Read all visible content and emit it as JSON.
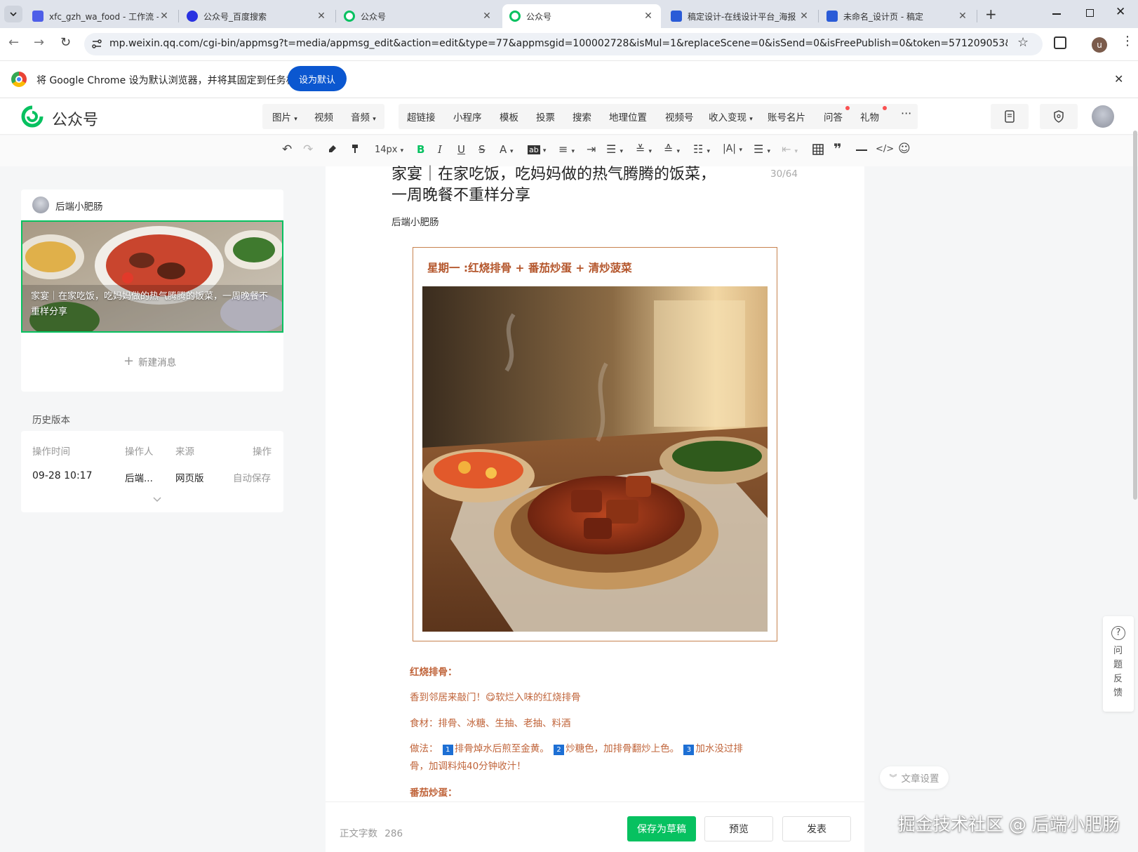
{
  "browser": {
    "tabs": [
      {
        "title": "xfc_gzh_wa_food - 工作流 -",
        "favicon": "coze-icon",
        "color": "#4e5ee8",
        "active": false
      },
      {
        "title": "公众号_百度搜索",
        "favicon": "baidu-paw-icon",
        "color": "#2932e1",
        "active": false
      },
      {
        "title": "公众号",
        "favicon": "wechat-mp-icon",
        "color": "#07c160",
        "active": false
      },
      {
        "title": "公众号",
        "favicon": "wechat-mp-icon",
        "color": "#07c160",
        "active": true
      },
      {
        "title": "稿定设计-在线设计平台_海报",
        "favicon": "gaoding-icon",
        "color": "#2a5bd7",
        "active": false
      },
      {
        "title": "未命名_设计页 - 稿定",
        "favicon": "gaoding-icon",
        "color": "#2a5bd7",
        "active": false
      }
    ],
    "url": "mp.weixin.qq.com/cgi-bin/appmsg?t=media/appmsg_edit&action=edit&type=77&appmsgid=100002728&isMul=1&replaceScene=0&isSend=0&isFreePublish=0&token=571209053&lang...",
    "profile_initial": "u",
    "infobar": {
      "message": "将 Google Chrome 设为默认浏览器，并将其固定到任务栏",
      "button": "设为默认"
    }
  },
  "app": {
    "logo_text": "公众号",
    "brand_color": "#07c160",
    "insert_menu": [
      "图片",
      "视频",
      "音频"
    ],
    "more_menu": [
      "超链接",
      "小程序",
      "模板",
      "投票",
      "搜索",
      "地理位置",
      "视频号",
      "收入变现",
      "账号名片",
      "问答",
      "礼物"
    ],
    "overflow": "···"
  },
  "toolbar": {
    "font_size": "14px"
  },
  "sidebar": {
    "account_name": "后端小肥肠",
    "cover_title": "家宴｜在家吃饭，吃妈妈做的热气腾腾的饭菜，一周晚餐不重样分享",
    "new_message": "新建消息",
    "history_title": "历史版本",
    "history_columns": [
      "操作时间",
      "操作人",
      "来源",
      "操作"
    ],
    "history_rows": [
      {
        "time": "09-28 10:17",
        "operator": "后端...",
        "source": "网页版",
        "action": "自动保存"
      }
    ]
  },
  "article": {
    "title": "家宴｜在家吃饭，吃妈妈做的热气腾腾的饭菜，一周晚餐不重样分享",
    "title_count": "30/64",
    "author": "后端小肥肠",
    "frame_heading": "星期一 :红烧排骨 + 番茄炒蛋 + 清炒菠菜",
    "section1_heading": "红烧排骨：",
    "section1_intro": "香到邻居来敲门！😋软烂入味的红烧排骨",
    "section1_ingredients": "食材：排骨、冰糖、生抽、老抽、料酒",
    "section1_method_label": "做法：",
    "section1_step1": "排骨焯水后煎至金黄。",
    "section1_step2": "炒糖色，加排骨翻炒上色。",
    "section1_step3": "加水没过排",
    "section1_method_line2": "骨，加调料炖40分钟收汁！",
    "section2_heading": "番茄炒蛋："
  },
  "footer": {
    "word_count_label": "正文字数",
    "word_count": "286",
    "save_draft": "保存为草稿",
    "preview": "预览",
    "publish": "发表"
  },
  "side_widgets": {
    "feedback": "问题反馈",
    "article_settings": "文章设置"
  },
  "watermark": "掘金技术社区 @ 后端小肥肠"
}
